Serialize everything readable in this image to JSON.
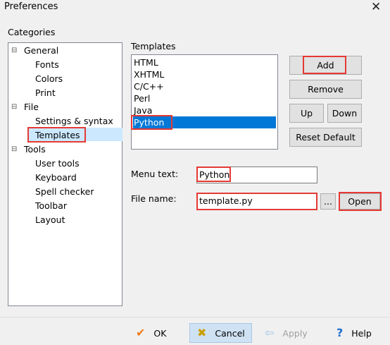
{
  "window": {
    "title": "Preferences",
    "close": "✕"
  },
  "categories": {
    "label": "Categories",
    "tree": [
      {
        "label": "General",
        "expander": "⊟"
      },
      {
        "label": "Fonts"
      },
      {
        "label": "Colors"
      },
      {
        "label": "Print"
      },
      {
        "label": "File",
        "expander": "⊟"
      },
      {
        "label": "Settings & syntax"
      },
      {
        "label": "Templates",
        "selected": true
      },
      {
        "label": "Tools",
        "expander": "⊟"
      },
      {
        "label": "User tools"
      },
      {
        "label": "Keyboard"
      },
      {
        "label": "Spell checker"
      },
      {
        "label": "Toolbar"
      },
      {
        "label": "Layout"
      }
    ]
  },
  "templates": {
    "label": "Templates",
    "items": [
      "HTML",
      "XHTML",
      "C/C++",
      "Perl",
      "Java",
      "Python"
    ],
    "selected": "Python",
    "buttons": {
      "add": "Add",
      "remove": "Remove",
      "up": "Up",
      "down": "Down",
      "reset_default": "Reset Default"
    }
  },
  "form": {
    "menu_text_label": "Menu text:",
    "menu_text_value": "Python",
    "file_name_label": "File name:",
    "file_name_value": "template.py",
    "browse_label": "...",
    "open_label": "Open"
  },
  "footer": {
    "ok": "OK",
    "cancel": "Cancel",
    "apply": "Apply",
    "help": "Help",
    "ok_icon": "✔",
    "cancel_icon": "✖",
    "apply_icon": "⇦",
    "help_icon": "?"
  },
  "colors": {
    "selection": "#0078d7",
    "tree_selection": "#cce8ff",
    "highlight_box": "#e53935"
  }
}
